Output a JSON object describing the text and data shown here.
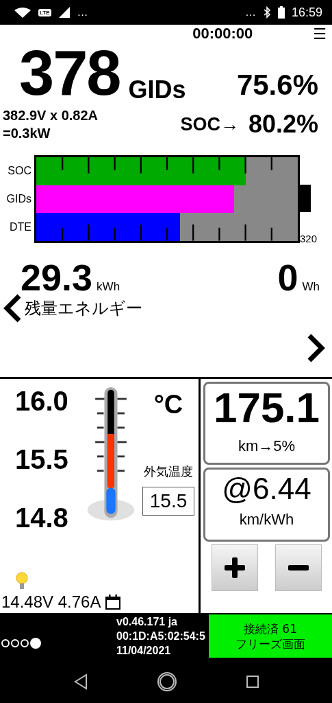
{
  "status_bar": {
    "left_more": "…",
    "right_more": "…",
    "time": "16:59",
    "lte": "LTE"
  },
  "header": {
    "timer": "00:00:00",
    "menu_icon": "☰"
  },
  "gids": {
    "value": "378",
    "unit": "GIDs",
    "percent": "75.6%"
  },
  "power": {
    "line1": "382.9V x 0.82A",
    "line2": "=0.3kW"
  },
  "soc": {
    "label": "SOC→",
    "value": "80.2%"
  },
  "gauge": {
    "max_label": "320",
    "bars": [
      {
        "label": "SOC",
        "level": 0.802,
        "color": "#00aa00",
        "kind": "top"
      },
      {
        "label": "GIDs",
        "level": 0.756,
        "color": "#ff00ff",
        "kind": "plain"
      },
      {
        "label": "DTE",
        "level": 0.55,
        "color": "#0000ff",
        "kind": "bottom"
      }
    ]
  },
  "energy": {
    "value": "29.3",
    "unit": "kWh",
    "label": "残量エネルギー",
    "right_value": "0",
    "right_unit": "Wh"
  },
  "temperature": {
    "scale": [
      "16.0",
      "15.5",
      "14.8"
    ],
    "unit": "°C",
    "label": "外気温度",
    "reading": "15.5",
    "level": 0.55
  },
  "aux_battery": {
    "text": "14.48V 4.76A"
  },
  "range": {
    "value": "175.1",
    "unit": "km→5%"
  },
  "efficiency": {
    "value": "@6.44",
    "unit": "km/kWh"
  },
  "buttons": [
    {
      "kind": "plus"
    },
    {
      "kind": "minus"
    }
  ],
  "footer": {
    "dots": [
      {
        "selected": false
      },
      {
        "selected": false
      },
      {
        "selected": false
      },
      {
        "selected": true
      }
    ],
    "info": [
      "v0.46.171 ja",
      "00:1D:A5:02:54:5",
      "11/04/2021"
    ],
    "status": [
      "接続済 61",
      "フリーズ画面"
    ]
  }
}
